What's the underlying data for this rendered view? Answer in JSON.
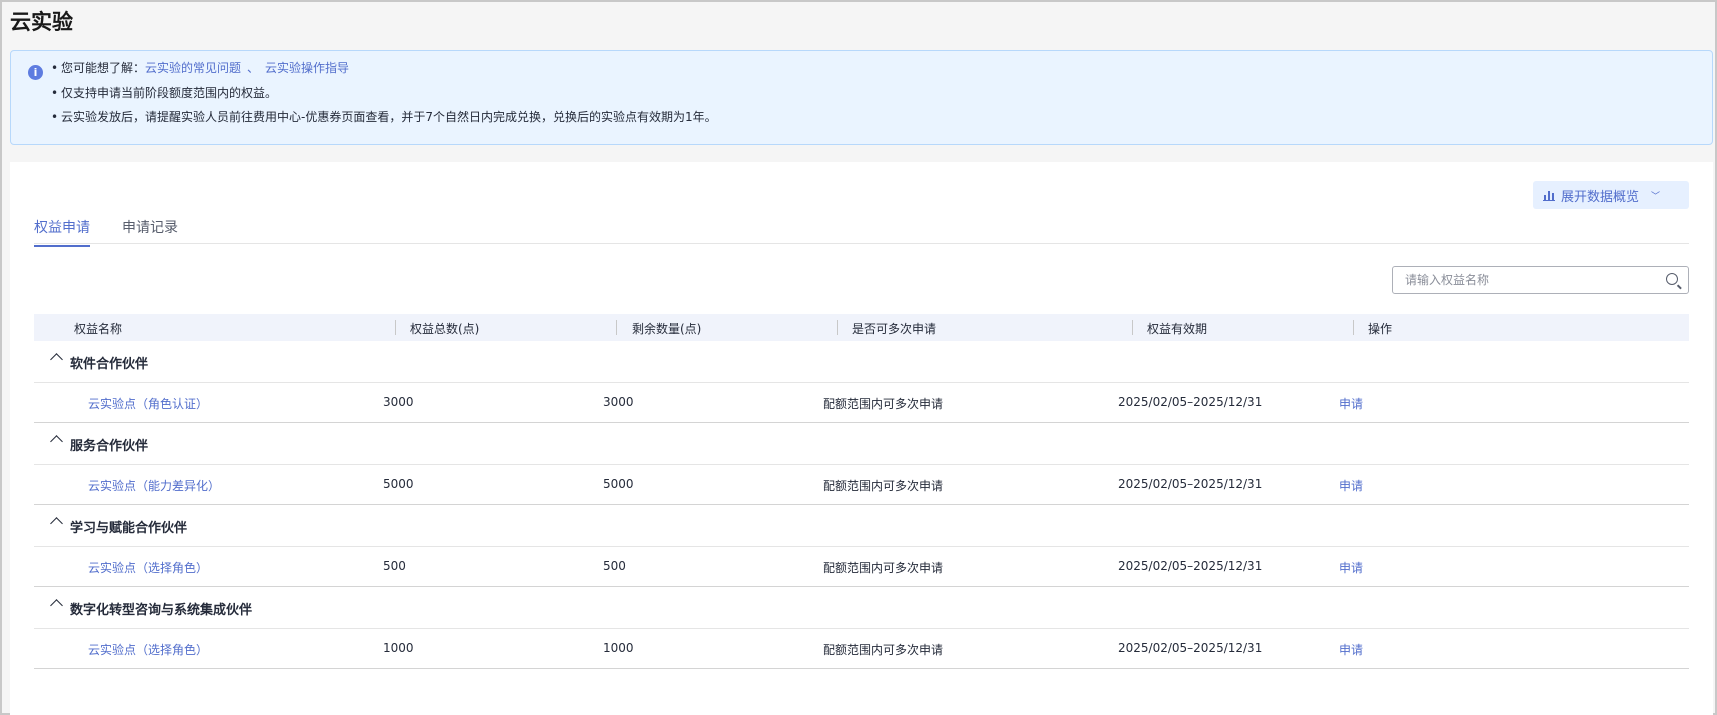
{
  "page": {
    "title": "云实验"
  },
  "notice": {
    "line1_prefix": "您可能想了解：",
    "link_faq": "云实验的常见问题",
    "link_separator": "、",
    "link_guide": "云实验操作指导",
    "line2": "仅支持申请当前阶段额度范围内的权益。",
    "line3": "云实验发放后，请提醒实验人员前往费用中心-优惠券页面查看，并于7个自然日内完成兑换，兑换后的实验点有效期为1年。"
  },
  "toolbar": {
    "overview_label": "展开数据概览"
  },
  "tabs": [
    {
      "label": "权益申请",
      "active": true
    },
    {
      "label": "申请记录",
      "active": false
    }
  ],
  "search": {
    "placeholder": "请输入权益名称",
    "value": ""
  },
  "table": {
    "columns": [
      "权益名称",
      "权益总数(点)",
      "剩余数量(点)",
      "是否可多次申请",
      "权益有效期",
      "操作"
    ],
    "groups": [
      {
        "name": "软件合作伙伴",
        "rows": [
          {
            "name": "云实验点（角色认证）",
            "total": "3000",
            "remaining": "3000",
            "repeat": "配额范围内可多次申请",
            "validity": "2025/02/05–2025/12/31",
            "action": "申请"
          }
        ]
      },
      {
        "name": "服务合作伙伴",
        "rows": [
          {
            "name": "云实验点（能力差异化）",
            "total": "5000",
            "remaining": "5000",
            "repeat": "配额范围内可多次申请",
            "validity": "2025/02/05–2025/12/31",
            "action": "申请"
          }
        ]
      },
      {
        "name": "学习与赋能合作伙伴",
        "rows": [
          {
            "name": "云实验点（选择角色）",
            "total": "500",
            "remaining": "500",
            "repeat": "配额范围内可多次申请",
            "validity": "2025/02/05–2025/12/31",
            "action": "申请"
          }
        ]
      },
      {
        "name": "数字化转型咨询与系统集成伙伴",
        "rows": [
          {
            "name": "云实验点（选择角色）",
            "total": "1000",
            "remaining": "1000",
            "repeat": "配额范围内可多次申请",
            "validity": "2025/02/05–2025/12/31",
            "action": "申请"
          }
        ]
      }
    ]
  },
  "colors": {
    "accent": "#526ecc",
    "notice_bg": "#eaf4ff",
    "header_bg": "#f0f3fb"
  },
  "icons": {
    "notice": "info-icon",
    "overview": "bar-chart-icon",
    "overview_toggle": "chevron-down-icon",
    "search": "search-icon",
    "group_toggle": "chevron-up-icon"
  }
}
